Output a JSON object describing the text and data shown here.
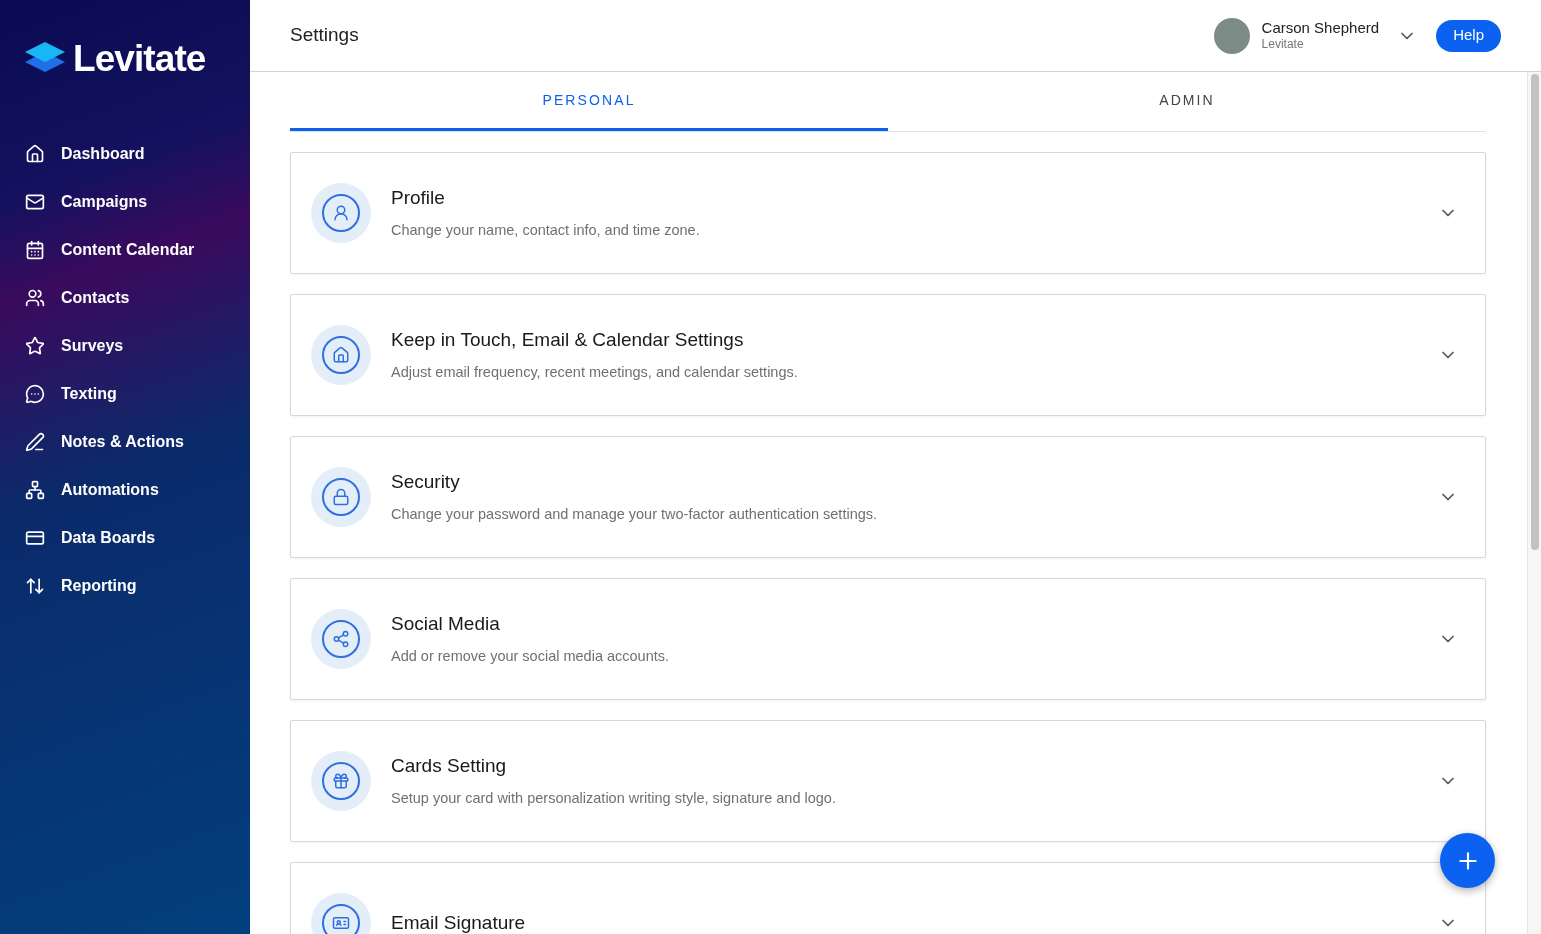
{
  "brand": "Levitate",
  "nav": [
    {
      "label": "Dashboard",
      "kind": "home"
    },
    {
      "label": "Campaigns",
      "kind": "mail"
    },
    {
      "label": "Content Calendar",
      "kind": "calendar"
    },
    {
      "label": "Contacts",
      "kind": "users"
    },
    {
      "label": "Surveys",
      "kind": "star"
    },
    {
      "label": "Texting",
      "kind": "chat"
    },
    {
      "label": "Notes & Actions",
      "kind": "pen"
    },
    {
      "label": "Automations",
      "kind": "tree"
    },
    {
      "label": "Data Boards",
      "kind": "card"
    },
    {
      "label": "Reporting",
      "kind": "report"
    }
  ],
  "header": {
    "title": "Settings",
    "user_name": "Carson Shepherd",
    "user_org": "Levitate",
    "help": "Help"
  },
  "tabs": [
    {
      "label": "PERSONAL",
      "selected": true
    },
    {
      "label": "ADMIN",
      "selected": false
    }
  ],
  "sections": [
    {
      "title": "Profile",
      "description": "Change your name, contact info, and time zone.",
      "kind": "user"
    },
    {
      "title": "Keep in Touch, Email & Calendar Settings",
      "description": "Adjust email frequency, recent meetings, and calendar settings.",
      "kind": "house"
    },
    {
      "title": "Security",
      "description": "Change your password and manage your two-factor authentication settings.",
      "kind": "lock"
    },
    {
      "title": "Social Media",
      "description": "Add or remove your social media accounts.",
      "kind": "share"
    },
    {
      "title": "Cards Setting",
      "description": "Setup your card with personalization writing style, signature and logo.",
      "kind": "gift"
    },
    {
      "title": "Email Signature",
      "kind": "signature"
    }
  ]
}
